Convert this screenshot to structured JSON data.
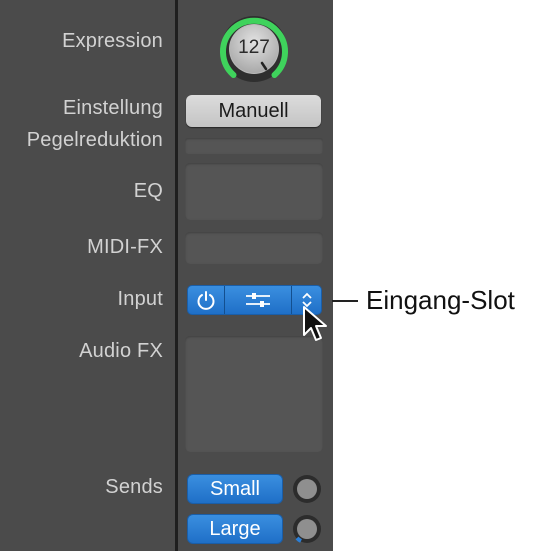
{
  "labels": {
    "expression": "Expression",
    "setting": "Einstellung",
    "gain_reduction": "Pegelreduktion",
    "eq": "EQ",
    "midi_fx": "MIDI-FX",
    "input": "Input",
    "audio_fx": "Audio FX",
    "sends": "Sends"
  },
  "expression_knob": {
    "value": "127",
    "level": 1.0,
    "ring_color": "#3fd35c"
  },
  "setting_button": {
    "label": "Manuell"
  },
  "sends": [
    {
      "label": "Small"
    },
    {
      "label": "Large"
    }
  ],
  "callout": {
    "text": "Eingang-Slot"
  },
  "colors": {
    "panel": "#4b4b4b",
    "accent_blue": "#2a7fd8",
    "label_text": "#d2d2d2"
  },
  "icons": {
    "input_power": "power-icon",
    "input_settings": "sliders-icon",
    "input_select": "chevron-updown-icon",
    "cursor": "mouse-pointer-icon"
  }
}
